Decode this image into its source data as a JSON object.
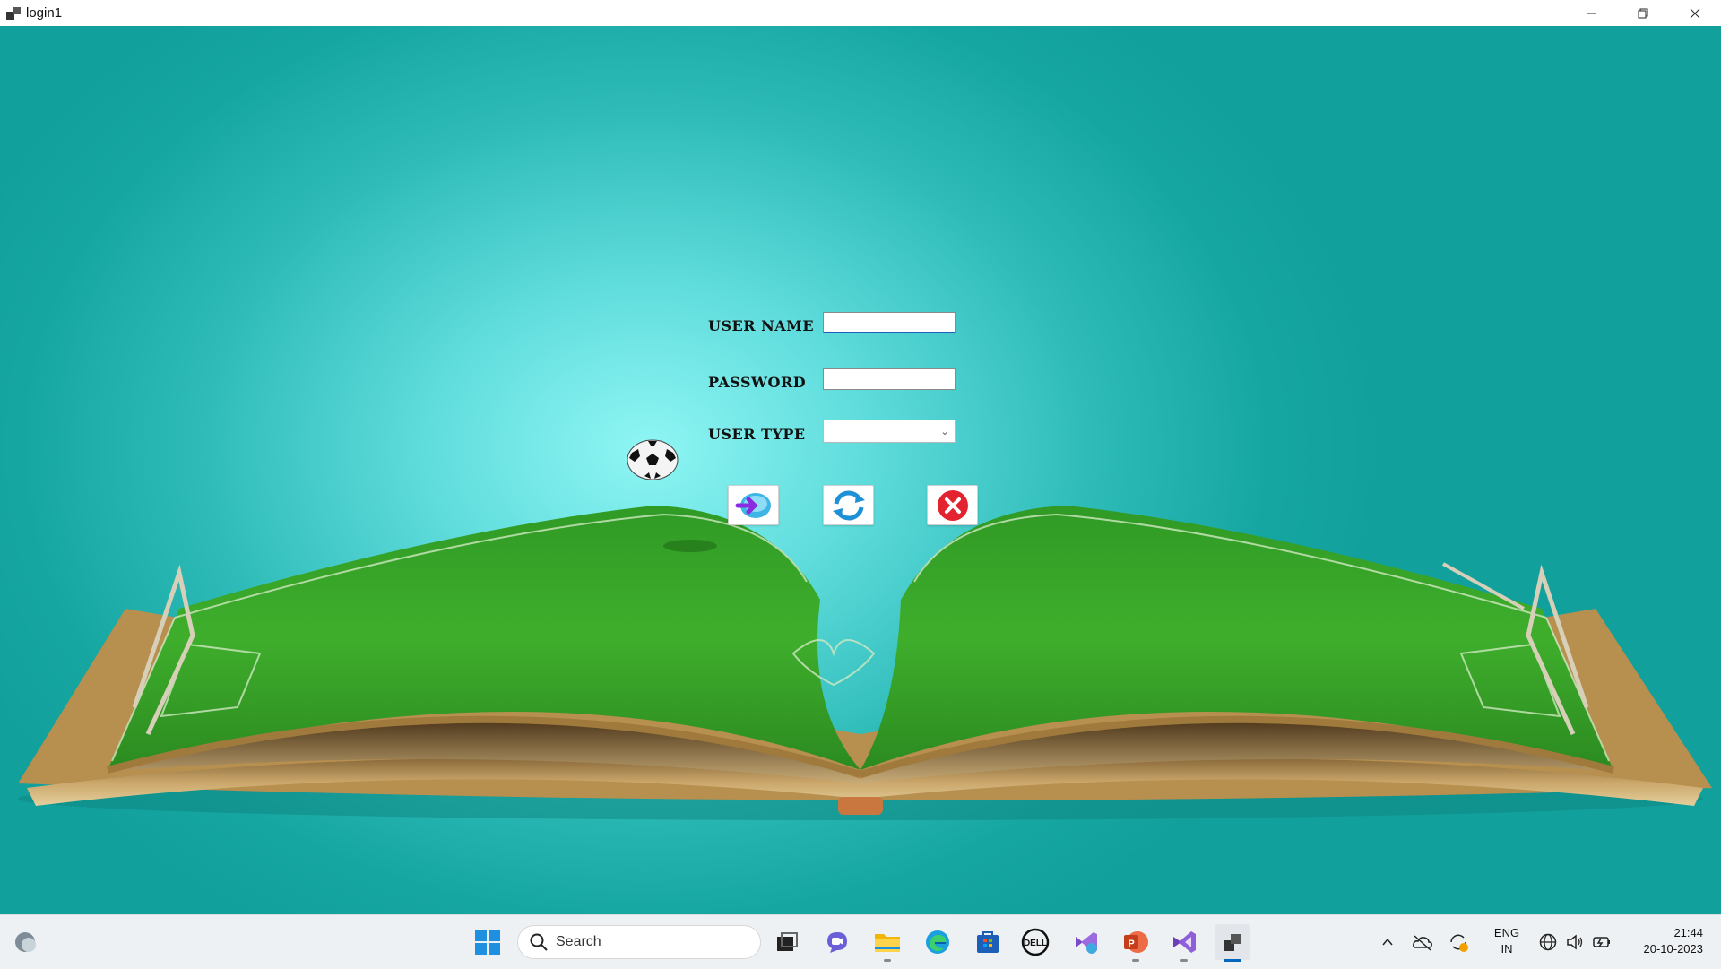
{
  "window": {
    "title": "login1",
    "icon": "app-window-icon",
    "controls": [
      "minimize-icon",
      "restore-icon",
      "close-icon"
    ]
  },
  "form": {
    "username_label": "USER NAME",
    "username_value": "",
    "password_label": "PASSWORD",
    "password_value": "",
    "usertype_label": "USER TYPE",
    "usertype_value": "",
    "buttons": [
      {
        "name": "login-button",
        "icon": "login-arrow-icon"
      },
      {
        "name": "refresh-button",
        "icon": "refresh-icon"
      },
      {
        "name": "exit-button",
        "icon": "close-circle-icon"
      }
    ]
  },
  "background": {
    "scene": "open book with football field",
    "accent": "#1aa9a5"
  },
  "taskbar": {
    "search_placeholder": "Search",
    "apps": [
      "windows-start-icon",
      "search-icon",
      "task-view-icon",
      "chat-icon",
      "file-explorer-icon",
      "edge-icon",
      "store-icon",
      "dell-icon",
      "visual-studio-installer-icon",
      "powerpoint-icon",
      "visual-studio-icon",
      "login1-app-icon"
    ],
    "tray": {
      "language_top": "ENG",
      "language_bottom": "IN",
      "time": "21:44",
      "date": "20-10-2023"
    }
  }
}
